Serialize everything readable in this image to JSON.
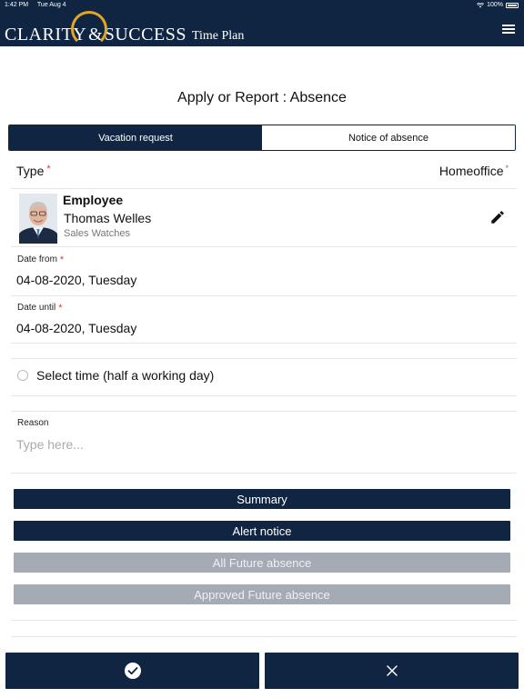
{
  "status_bar": {
    "time": "1:42 PM",
    "date": "Tue Aug 4",
    "battery": "100%"
  },
  "header": {
    "brand_clarity": "CLARITY",
    "brand_amp": "&",
    "brand_success": "SUCCESS",
    "brand_sub": "Time Plan",
    "menu_icon": "hamburger-menu-icon"
  },
  "page": {
    "title": "Apply or Report : Absence"
  },
  "tabs": [
    {
      "label": "Vacation request",
      "active": true
    },
    {
      "label": "Notice of absence",
      "active": false
    }
  ],
  "type_field": {
    "label": "Type",
    "required_mark": "*",
    "value": "Homeoffice",
    "chevron": "*"
  },
  "employee": {
    "heading": "Employee",
    "name": "Thomas Welles",
    "department": "Sales Watches",
    "edit_icon": "pencil-icon"
  },
  "date_from": {
    "label": "Date from",
    "required_mark": "*",
    "value": "04-08-2020, Tuesday"
  },
  "date_until": {
    "label": "Date until",
    "required_mark": "*",
    "value": "04-08-2020, Tuesday"
  },
  "half_day": {
    "label": "Select time (half a working day)",
    "checked": false
  },
  "reason": {
    "label": "Reason",
    "placeholder": "Type here...",
    "value": ""
  },
  "actions": [
    {
      "label": "Summary",
      "enabled": true
    },
    {
      "label": "Alert notice",
      "enabled": true
    },
    {
      "label": "All Future absence",
      "enabled": false
    },
    {
      "label": "Approved Future absence",
      "enabled": false
    }
  ],
  "footer": {
    "confirm_icon": "check-circle-icon",
    "cancel_icon": "close-icon"
  },
  "colors": {
    "navy": "#0f2542",
    "gold": "#e3a623",
    "disabled": "#a5abb4",
    "required": "#d23b3b"
  }
}
